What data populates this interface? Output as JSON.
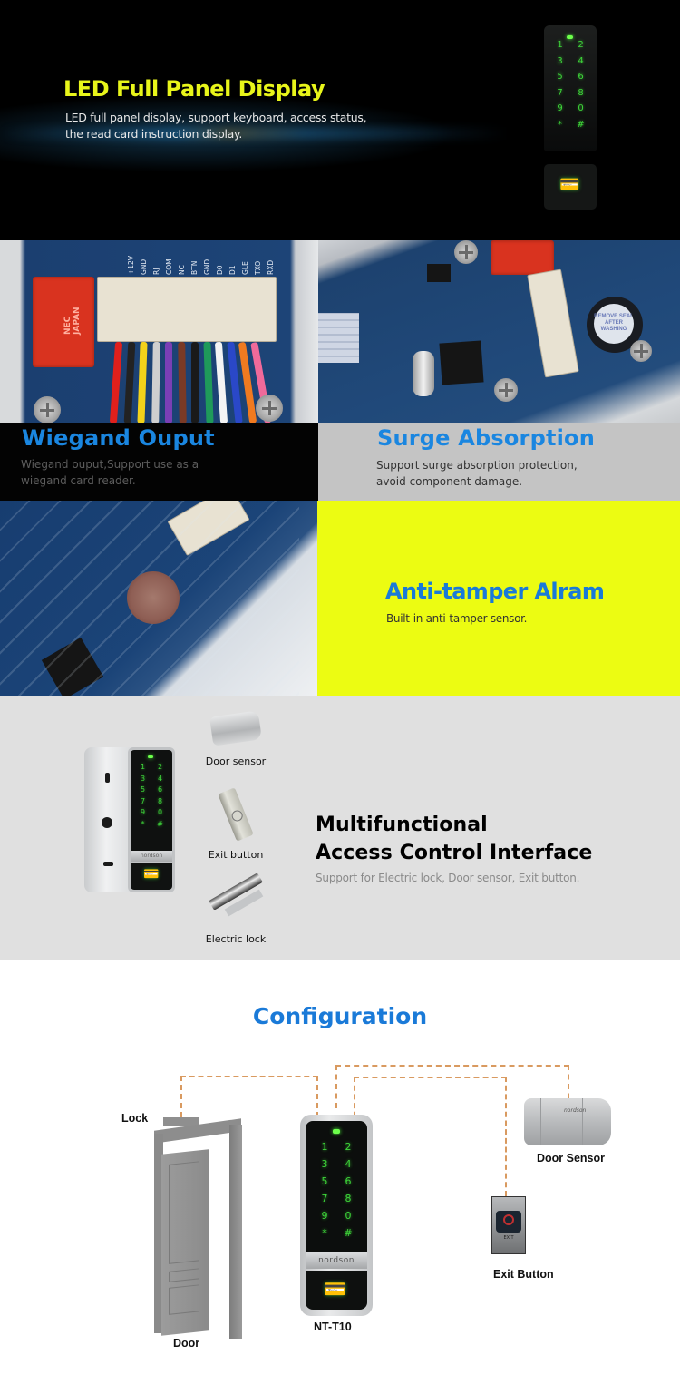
{
  "led_section": {
    "title": "LED Full Panel Display",
    "description_line1": "LED full panel display, support keyboard, access status,",
    "description_line2": "the read card instruction display.",
    "keypad_keys": [
      "1",
      "2",
      "3",
      "4",
      "5",
      "6",
      "7",
      "8",
      "9",
      "0",
      "*",
      "#"
    ]
  },
  "wiegand_section": {
    "title": "Wiegand Ouput",
    "description_line1": "Wiegand ouput,Support use as a",
    "description_line2": "wiegand card reader.",
    "pcb_labels": [
      "+12V",
      "GND",
      "RJ",
      "COM",
      "NC",
      "BTN",
      "GND",
      "D0",
      "D1",
      "GLE",
      "TXO",
      "RXD"
    ],
    "relay_text": "NEC JAPAN"
  },
  "surge_section": {
    "title": "Surge Absorption",
    "description_line1": "Support surge absorption protection,",
    "description_line2": "avoid component damage.",
    "buzzer_label": "REMOVE SEAL AFTER WASHING"
  },
  "tamper_section": {
    "title": "Anti-tamper Alram",
    "description": "Built-in anti-tamper sensor."
  },
  "interface_section": {
    "title_line1": "Multifunctional",
    "title_line2": "Access Control Interface",
    "description": "Support for Electric lock, Door sensor, Exit button.",
    "brand": "nordson",
    "accessories": [
      {
        "label": "Door sensor"
      },
      {
        "label": "Exit button"
      },
      {
        "label": "Electric lock"
      }
    ]
  },
  "configuration_section": {
    "title": "Configuration",
    "labels": {
      "lock": "Lock",
      "door": "Door",
      "reader": "NT-T10",
      "door_sensor": "Door Sensor",
      "exit_button": "Exit Button"
    },
    "brand": "nordson",
    "exit_plate_text": "EXIT"
  },
  "colors": {
    "heading_yellow": "#e8f51a",
    "heading_blue": "#1a86e0",
    "panel_yellow": "#ecfc12",
    "led_green": "#3ed63a",
    "wire_dash": "#d99a60"
  }
}
